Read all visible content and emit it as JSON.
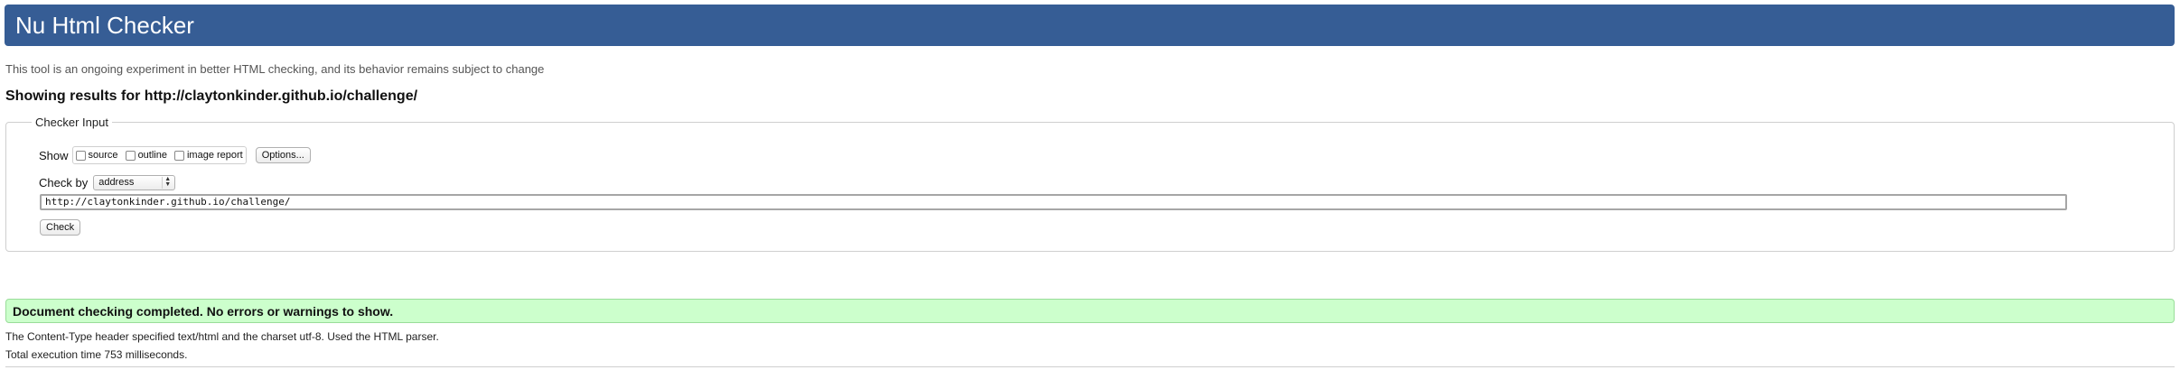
{
  "header": {
    "title": "Nu Html Checker"
  },
  "intro": {
    "text": "This tool is an ongoing experiment in better HTML checking, and its behavior remains subject to change"
  },
  "results_for": {
    "text": "Showing results for http://claytonkinder.github.io/challenge/"
  },
  "checker_input": {
    "legend": "Checker Input",
    "show_label": "Show",
    "checkboxes": [
      {
        "label": "source",
        "checked": false
      },
      {
        "label": "outline",
        "checked": false
      },
      {
        "label": "image report",
        "checked": false
      }
    ],
    "options_button": "Options...",
    "check_by_label": "Check by",
    "check_by_value": "address",
    "url_value": "http://claytonkinder.github.io/challenge/",
    "check_button": "Check"
  },
  "result": {
    "status": "Document checking completed. No errors or warnings to show.",
    "content_type_note": "The Content-Type header specified text/html and the charset utf-8. Used the HTML parser.",
    "execution_time": "Total execution time 753 milliseconds."
  },
  "colors": {
    "header_bg": "#365d95",
    "success_bg": "#ccffcc"
  }
}
